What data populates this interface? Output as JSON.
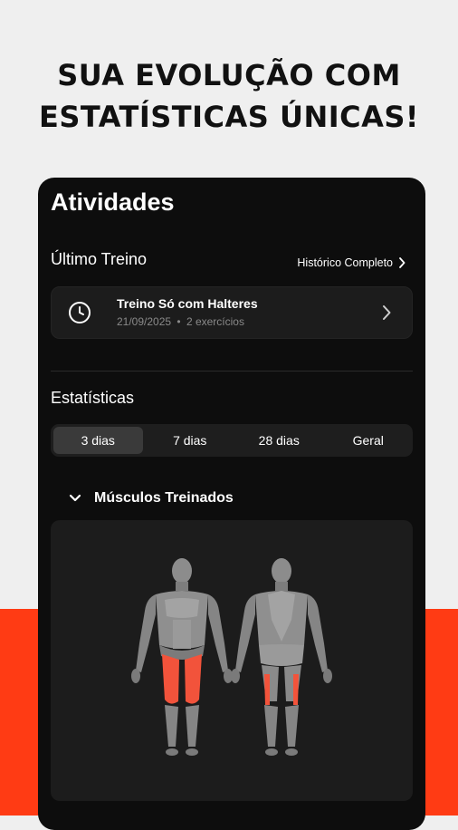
{
  "promo": {
    "line1": "SUA EVOLUÇÃO COM",
    "line2": "ESTATÍSTICAS ÚNICAS!",
    "accent_color": "#ff3b14"
  },
  "screen": {
    "title": "Atividades"
  },
  "last_workout": {
    "section_title": "Último Treino",
    "history_link": "Histórico Completo",
    "card": {
      "title": "Treino Só com Halteres",
      "date": "21/09/2025",
      "separator": "•",
      "exercises": "2 exercícios",
      "icon": "clock-icon"
    }
  },
  "stats": {
    "section_title": "Estatísticas",
    "ranges": [
      "3 dias",
      "7 dias",
      "28 dias",
      "Geral"
    ],
    "selected_range": "3 dias"
  },
  "muscles": {
    "label": "Músculos Treinados",
    "highlight_color": "#f2533b",
    "trained": [
      "quadriceps",
      "hamstrings"
    ]
  }
}
